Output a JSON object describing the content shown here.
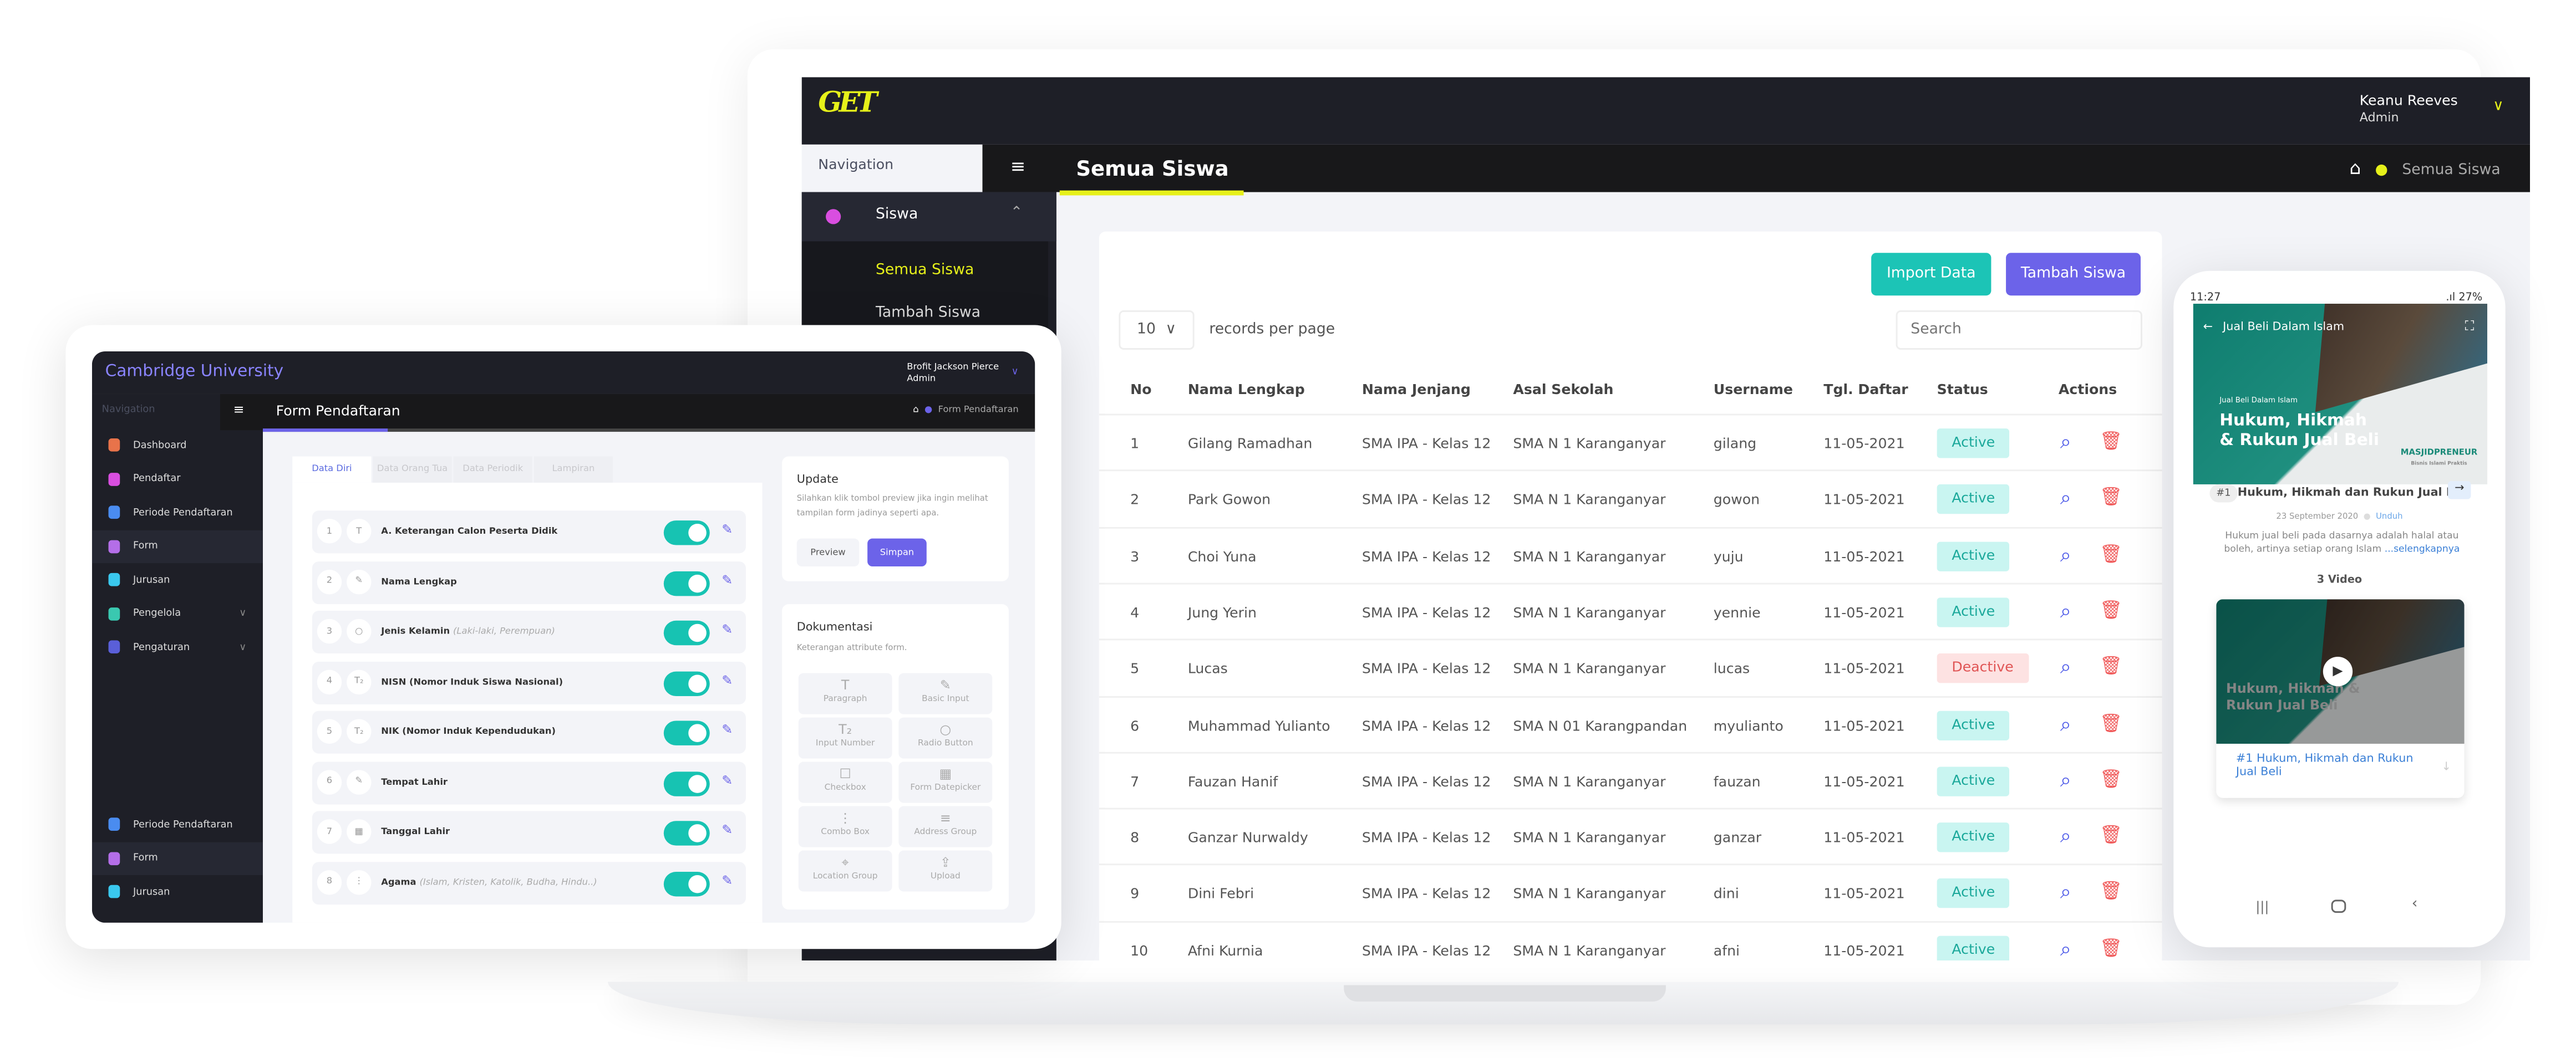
{
  "laptop": {
    "logo": "GET",
    "user": {
      "name": "Keanu Reeves",
      "role": "Admin"
    },
    "nav_label": "Navigation",
    "title": "Semua Siswa",
    "breadcrumb": "Semua Siswa",
    "sidebar": {
      "group": "Siswa",
      "items": [
        "Semua Siswa",
        "Tambah Siswa"
      ]
    },
    "buttons": {
      "import": "Import Data",
      "add": "Tambah Siswa"
    },
    "per_page": "10",
    "per_page_label": "records per page",
    "search_placeholder": "Search",
    "columns": [
      "No",
      "Nama Lengkap",
      "Nama Jenjang",
      "Asal Sekolah",
      "Username",
      "Tgl. Daftar",
      "Status",
      "Actions"
    ],
    "rows": [
      [
        "1",
        "Gilang Ramadhan",
        "SMA IPA - Kelas 12",
        "SMA N 1 Karanganyar",
        "gilang",
        "11-05-2021",
        "Active"
      ],
      [
        "2",
        "Park Gowon",
        "SMA IPA - Kelas 12",
        "SMA N 1 Karanganyar",
        "gowon",
        "11-05-2021",
        "Active"
      ],
      [
        "3",
        "Choi Yuna",
        "SMA IPA - Kelas 12",
        "SMA N 1 Karanganyar",
        "yuju",
        "11-05-2021",
        "Active"
      ],
      [
        "4",
        "Jung Yerin",
        "SMA IPA - Kelas 12",
        "SMA N 1 Karanganyar",
        "yennie",
        "11-05-2021",
        "Active"
      ],
      [
        "5",
        "Lucas",
        "SMA IPA - Kelas 12",
        "SMA N 1 Karanganyar",
        "lucas",
        "11-05-2021",
        "Deactive"
      ],
      [
        "6",
        "Muhammad Yulianto",
        "SMA IPA - Kelas 12",
        "SMA N 01 Karangpandan",
        "myulianto",
        "11-05-2021",
        "Active"
      ],
      [
        "7",
        "Fauzan Hanif",
        "SMA IPA - Kelas 12",
        "SMA N 1 Karanganyar",
        "fauzan",
        "11-05-2021",
        "Active"
      ],
      [
        "8",
        "Ganzar Nurwaldy",
        "SMA IPA - Kelas 12",
        "SMA N 1 Karanganyar",
        "ganzar",
        "11-05-2021",
        "Active"
      ],
      [
        "9",
        "Dini Febri",
        "SMA IPA - Kelas 12",
        "SMA N 1 Karanganyar",
        "dini",
        "11-05-2021",
        "Active"
      ],
      [
        "10",
        "Afni Kurnia",
        "SMA IPA - Kelas 12",
        "SMA N 1 Karanganyar",
        "afni",
        "11-05-2021",
        "Active"
      ]
    ],
    "colors": {
      "accent": "#e6f01a",
      "teal": "#1cc4b6",
      "purple": "#6c63e9",
      "active_bg": "#c9f5f1",
      "deactive_bg": "#fde2e2",
      "deactive_fg": "#e05555"
    }
  },
  "tablet": {
    "logo": "Cambridge University",
    "user": {
      "name": "Brofit Jackson Pierce",
      "role": "Admin"
    },
    "nav_label": "Navigation",
    "title": "Form Pendaftaran",
    "breadcrumb": "Form Pendaftaran",
    "sidebar": [
      {
        "label": "Dashboard",
        "color": "#e8734a"
      },
      {
        "label": "Pendaftar",
        "color": "#d94ee0"
      },
      {
        "label": "Periode Pendaftaran",
        "color": "#4a8cf0"
      },
      {
        "label": "Form",
        "color": "#b46ee8"
      },
      {
        "label": "Jurusan",
        "color": "#3ac8ee"
      },
      {
        "label": "Pengelola",
        "color": "#3ac8b0"
      },
      {
        "label": "Pengaturan",
        "color": "#5a5fd8"
      }
    ],
    "sidebar_bottom": [
      "Periode Pendaftaran",
      "Form",
      "Jurusan"
    ],
    "tabs": [
      "Data Diri",
      "Data Orang Tua",
      "Data Periodik",
      "Lampiran"
    ],
    "fields": [
      {
        "n": "1",
        "icon": "T",
        "label": "A. Keterangan Calon Peserta Didik",
        "hint": ""
      },
      {
        "n": "2",
        "icon": "✎",
        "label": "Nama Lengkap",
        "hint": ""
      },
      {
        "n": "3",
        "icon": "○",
        "label": "Jenis Kelamin",
        "hint": "(Laki-laki, Perempuan)"
      },
      {
        "n": "4",
        "icon": "T₂",
        "label": "NISN (Nomor Induk Siswa Nasional)",
        "hint": ""
      },
      {
        "n": "5",
        "icon": "T₂",
        "label": "NIK (Nomor Induk Kependudukan)",
        "hint": ""
      },
      {
        "n": "6",
        "icon": "✎",
        "label": "Tempat Lahir",
        "hint": ""
      },
      {
        "n": "7",
        "icon": "▦",
        "label": "Tanggal Lahir",
        "hint": ""
      },
      {
        "n": "8",
        "icon": "⋮",
        "label": "Agama",
        "hint": "(Islam, Kristen, Katolik, Budha, Hindu..)"
      }
    ],
    "update": {
      "title": "Update",
      "text": "Silahkan klik tombol preview jika ingin melihat tampilan form jadinya seperti apa.",
      "preview": "Preview",
      "save": "Simpan"
    },
    "docs": {
      "title": "Dokumentasi",
      "text": "Keterangan attribute form.",
      "items": [
        {
          "icon": "T",
          "label": "Paragraph"
        },
        {
          "icon": "✎",
          "label": "Basic Input"
        },
        {
          "icon": "T₂",
          "label": "Input Number"
        },
        {
          "icon": "○",
          "label": "Radio Button"
        },
        {
          "icon": "☐",
          "label": "Checkbox"
        },
        {
          "icon": "▦",
          "label": "Form Datepicker"
        },
        {
          "icon": "⋮",
          "label": "Combo Box"
        },
        {
          "icon": "≡",
          "label": "Address Group"
        },
        {
          "icon": "⌖",
          "label": "Location Group"
        },
        {
          "icon": "⇪",
          "label": "Upload"
        }
      ]
    }
  },
  "phone": {
    "time": "11:27",
    "battery": "27%",
    "header": "Jual Beli Dalam Islam",
    "banner": {
      "kicker": "Jual Beli Dalam Islam",
      "title": "Hukum, Hikmah & Rukun Jual Beli",
      "brand": "MASJIDPRENEUR",
      "brand_sub": "Bisnis Islami Praktis"
    },
    "badge": "#1",
    "title": "Hukum, Hikmah dan Rukun Jual Beli",
    "date": "23 September 2020",
    "download": "Unduh",
    "desc": "Hukum jual beli pada dasarnya adalah halal atau boleh, artinya setiap orang Islam ",
    "more": "...selengkapnya",
    "count": "3 Video",
    "video_title": "#1 Hukum, Hikmah dan Rukun Jual Beli"
  }
}
